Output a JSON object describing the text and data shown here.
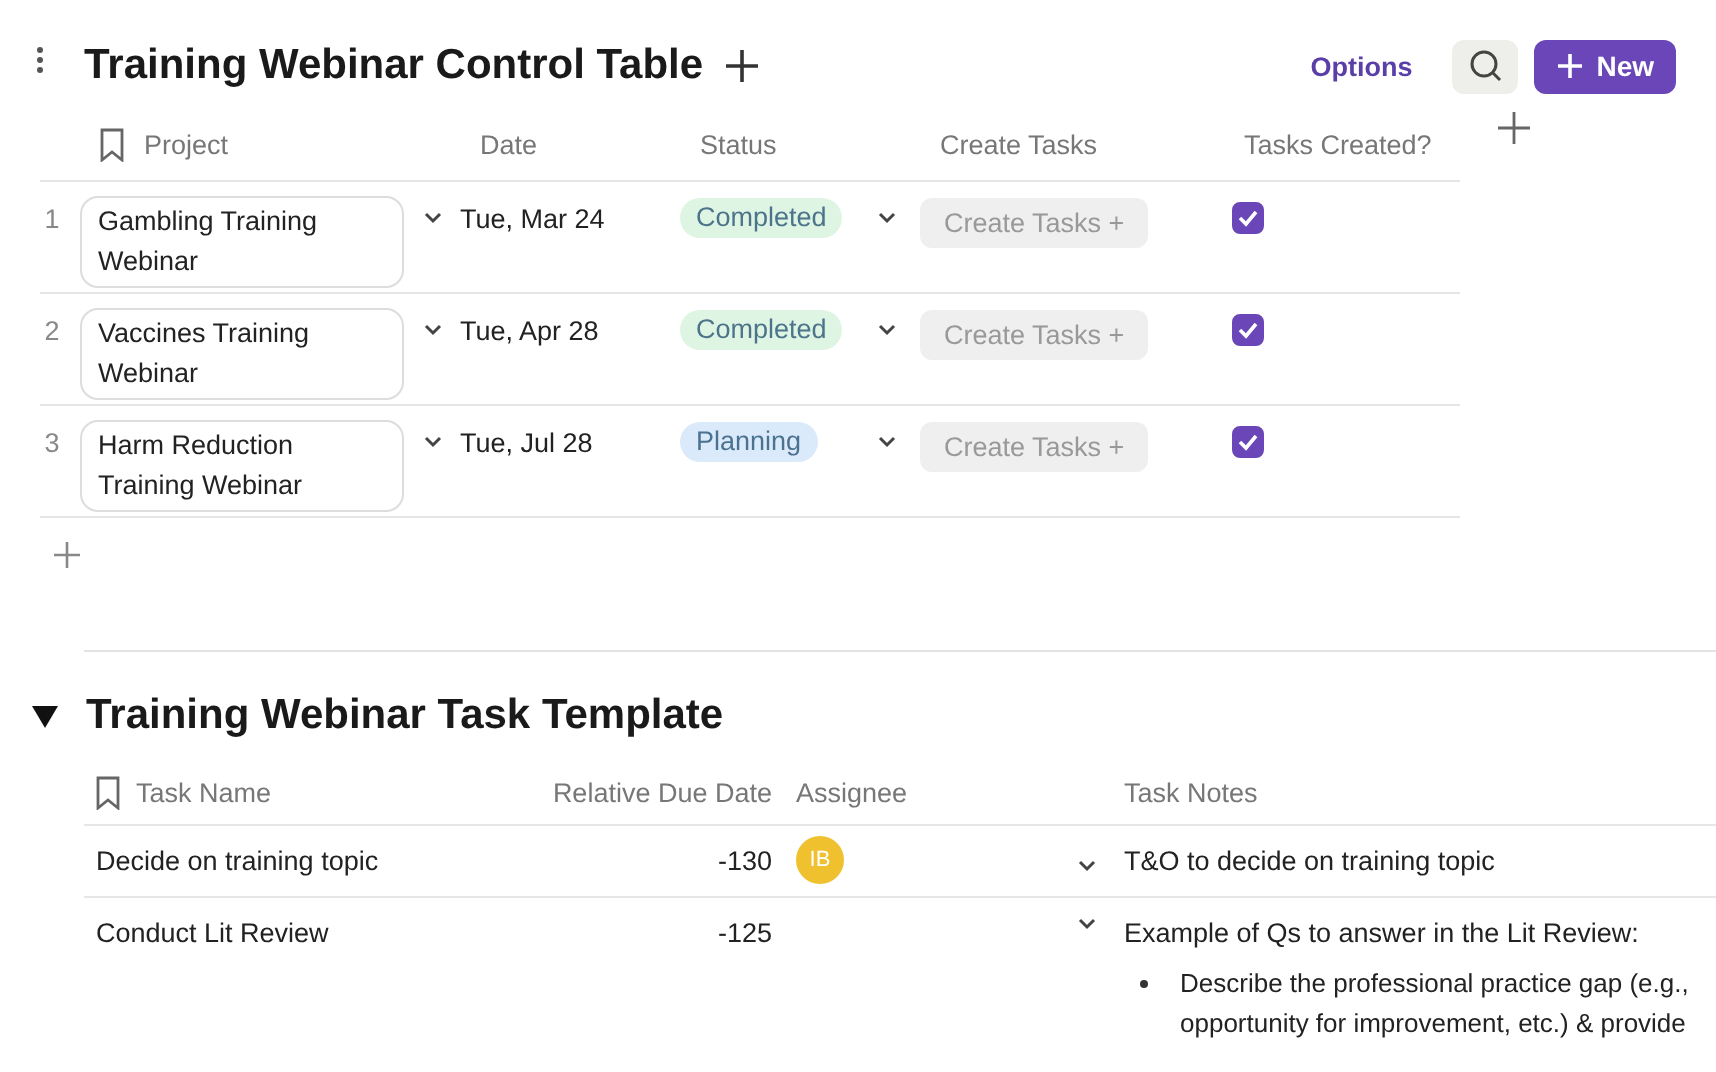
{
  "control_table": {
    "title": "Training Webinar Control Table",
    "options_label": "Options",
    "new_button": "New",
    "columns": [
      "Project",
      "Date",
      "Status",
      "Create Tasks",
      "Tasks Created?"
    ],
    "rows": [
      {
        "number": "1",
        "project": "Gambling Training Webinar",
        "date": "Tue, Mar 24",
        "status": "Completed",
        "color": "#dff5e3",
        "action": "Create Tasks +",
        "checked": true
      },
      {
        "number": "2",
        "project": "Vaccines Training Webinar",
        "date": "Tue, Apr 28",
        "status": "Completed",
        "color": "#dff5e3",
        "action": "Create Tasks +",
        "checked": true
      },
      {
        "number": "3",
        "project": "Harm Reduction Training Webinar",
        "date": "Tue, Jul 28",
        "status": "Planning",
        "color": "#dbeafb",
        "action": "Create Tasks +",
        "checked": true
      }
    ]
  },
  "task_template": {
    "title": "Training Webinar Task Template",
    "expanded": true,
    "columns": [
      "Task Name",
      "Relative Due Date",
      "Assignee",
      "Task Notes"
    ],
    "rows": [
      {
        "task": "Decide on training topic",
        "due": "-130",
        "assignee": "IB",
        "note": "T&O to decide on training topic"
      },
      {
        "task": "Conduct Lit Review",
        "due": "-125",
        "note": "Example of Qs to answer in the Lit Review:",
        "bullets": [
          {
            "lines": [
              "Describe the professional practice gap (e.g.,",
              "opportunity for improvement, etc.) & provide"
            ]
          }
        ]
      }
    ]
  }
}
